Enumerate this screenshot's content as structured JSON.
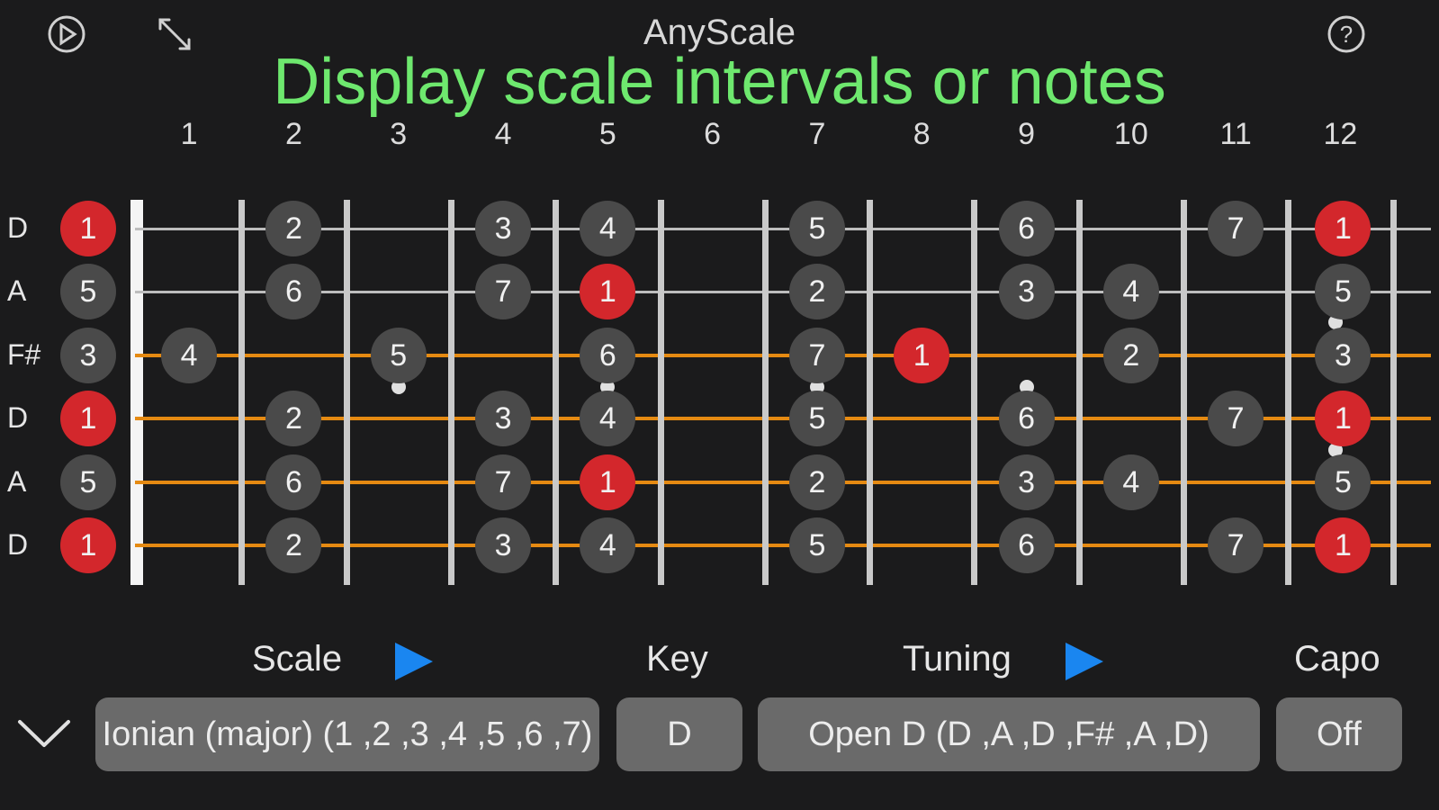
{
  "header": {
    "app_title": "AnyScale",
    "headline": "Display scale intervals or notes",
    "icons": [
      "play-circle-icon",
      "expand-icon",
      "help-icon"
    ]
  },
  "fret_numbers": [
    "1",
    "2",
    "3",
    "4",
    "5",
    "6",
    "7",
    "8",
    "9",
    "10",
    "11",
    "12"
  ],
  "strings": [
    {
      "label": "D",
      "notes": [
        {
          "fret": 0,
          "v": "1",
          "root": true
        },
        {
          "fret": 2,
          "v": "2"
        },
        {
          "fret": 4,
          "v": "3"
        },
        {
          "fret": 5,
          "v": "4"
        },
        {
          "fret": 7,
          "v": "5"
        },
        {
          "fret": 9,
          "v": "6"
        },
        {
          "fret": 11,
          "v": "7"
        },
        {
          "fret": 12,
          "v": "1",
          "root": true
        }
      ]
    },
    {
      "label": "A",
      "notes": [
        {
          "fret": 0,
          "v": "5"
        },
        {
          "fret": 2,
          "v": "6"
        },
        {
          "fret": 4,
          "v": "7"
        },
        {
          "fret": 5,
          "v": "1",
          "root": true
        },
        {
          "fret": 7,
          "v": "2"
        },
        {
          "fret": 9,
          "v": "3"
        },
        {
          "fret": 10,
          "v": "4"
        },
        {
          "fret": 12,
          "v": "5"
        }
      ]
    },
    {
      "label": "F#",
      "notes": [
        {
          "fret": 0,
          "v": "3"
        },
        {
          "fret": 1,
          "v": "4"
        },
        {
          "fret": 3,
          "v": "5"
        },
        {
          "fret": 5,
          "v": "6"
        },
        {
          "fret": 7,
          "v": "7"
        },
        {
          "fret": 8,
          "v": "1",
          "root": true
        },
        {
          "fret": 10,
          "v": "2"
        },
        {
          "fret": 12,
          "v": "3"
        }
      ]
    },
    {
      "label": "D",
      "notes": [
        {
          "fret": 0,
          "v": "1",
          "root": true
        },
        {
          "fret": 2,
          "v": "2"
        },
        {
          "fret": 4,
          "v": "3"
        },
        {
          "fret": 5,
          "v": "4"
        },
        {
          "fret": 7,
          "v": "5"
        },
        {
          "fret": 9,
          "v": "6"
        },
        {
          "fret": 11,
          "v": "7"
        },
        {
          "fret": 12,
          "v": "1",
          "root": true
        }
      ]
    },
    {
      "label": "A",
      "notes": [
        {
          "fret": 0,
          "v": "5"
        },
        {
          "fret": 2,
          "v": "6"
        },
        {
          "fret": 4,
          "v": "7"
        },
        {
          "fret": 5,
          "v": "1",
          "root": true
        },
        {
          "fret": 7,
          "v": "2"
        },
        {
          "fret": 9,
          "v": "3"
        },
        {
          "fret": 10,
          "v": "4"
        },
        {
          "fret": 12,
          "v": "5"
        }
      ]
    },
    {
      "label": "D",
      "notes": [
        {
          "fret": 0,
          "v": "1",
          "root": true
        },
        {
          "fret": 2,
          "v": "2"
        },
        {
          "fret": 4,
          "v": "3"
        },
        {
          "fret": 5,
          "v": "4"
        },
        {
          "fret": 7,
          "v": "5"
        },
        {
          "fret": 9,
          "v": "6"
        },
        {
          "fret": 11,
          "v": "7"
        },
        {
          "fret": 12,
          "v": "1",
          "root": true
        }
      ]
    }
  ],
  "controls": {
    "scale_label": "Scale",
    "key_label": "Key",
    "tuning_label": "Tuning",
    "capo_label": "Capo",
    "scale_value": "Ionian (major) (1 ,2 ,3 ,4 ,5 ,6 ,7)",
    "key_value": "D",
    "tuning_value": "Open D (D ,A ,D ,F# ,A ,D)",
    "capo_value": "Off"
  },
  "colors": {
    "headline": "#6ee86e",
    "root_note": "#d3272c",
    "note": "#4a4a4a",
    "string_gray": "#bdbdbd",
    "string_orange": "#e58a12",
    "play_blue": "#1a86f0"
  }
}
